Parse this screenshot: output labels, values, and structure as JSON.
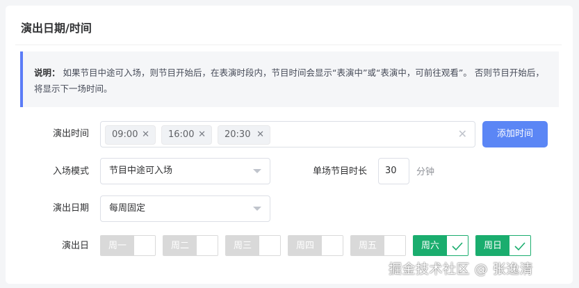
{
  "section": {
    "title": "演出日期/时间"
  },
  "notice": {
    "label": "说明：",
    "text": " 如果节目中途可入场，则节目开始后，在表演时段内，节目时间会显示“表演中”或“表演中，可前往观看”。 否则节目开始后，将显示下一场时间。"
  },
  "show_time": {
    "label": "演出时间",
    "tags": [
      "09:00",
      "16:00",
      "20:30"
    ],
    "add_button": "添加时间",
    "accent": "#5b86f5"
  },
  "entry_mode": {
    "label": "入场模式",
    "value": "节目中途可入场"
  },
  "duration": {
    "label": "单场节目时长",
    "value": "30",
    "unit": "分钟"
  },
  "show_date": {
    "label": "演出日期",
    "value": "每周固定"
  },
  "show_days": {
    "label": "演出日",
    "days": [
      {
        "name": "周一",
        "checked": false
      },
      {
        "name": "周二",
        "checked": false
      },
      {
        "name": "周三",
        "checked": false
      },
      {
        "name": "周四",
        "checked": false
      },
      {
        "name": "周五",
        "checked": false
      },
      {
        "name": "周六",
        "checked": true
      },
      {
        "name": "周日",
        "checked": true
      }
    ],
    "checked_color": "#1aad6e",
    "unchecked_color": "#d9d9d9"
  },
  "watermark": "掘金技术社区 @ 张逸清"
}
